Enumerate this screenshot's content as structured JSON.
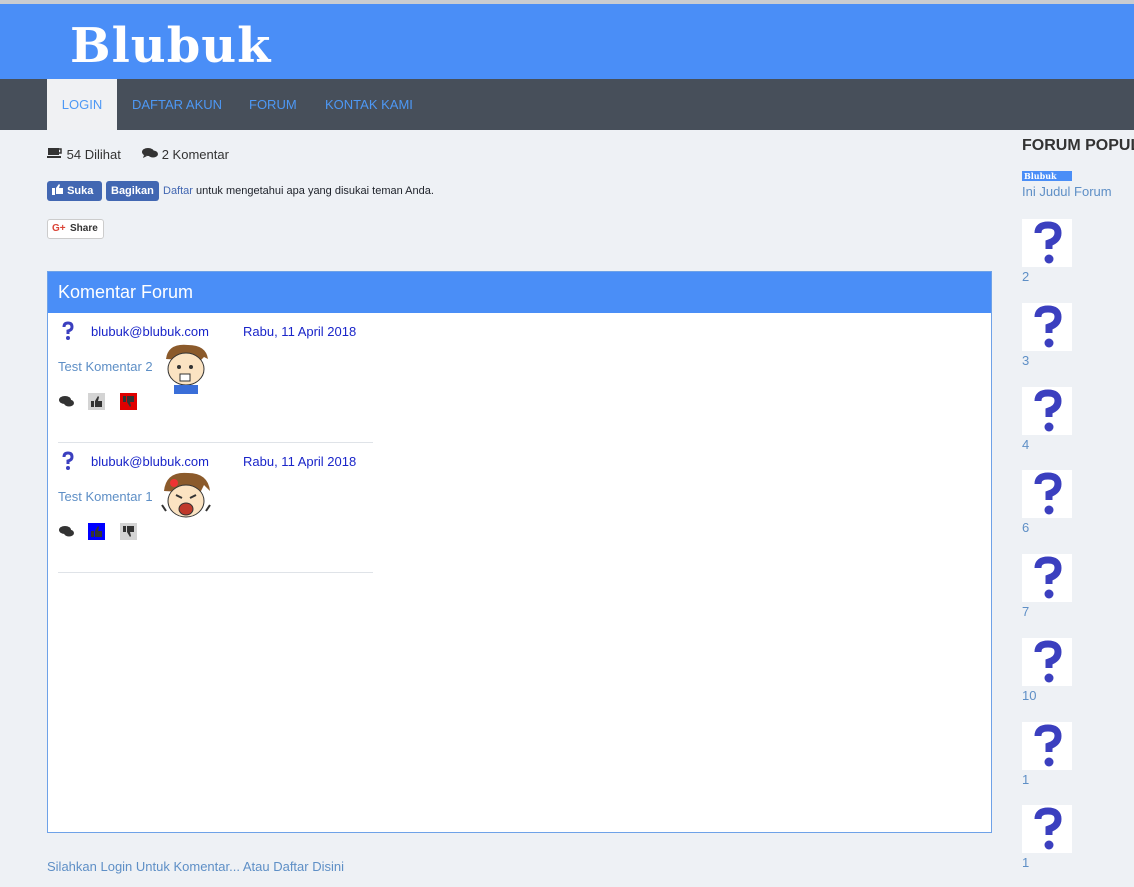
{
  "site": {
    "logo": "Blubuk"
  },
  "nav": {
    "items": [
      "LOGIN",
      "DAFTAR AKUN",
      "FORUM",
      "KONTAK KAMI"
    ]
  },
  "stats": {
    "views": "54 Dilihat",
    "comments": "2 Komentar"
  },
  "facebook": {
    "like_label": "Suka",
    "share_label": "Bagikan",
    "signup_link": "Daftar",
    "text": " untuk mengetahui apa yang disukai teman Anda."
  },
  "gplus": {
    "share_label": "Share"
  },
  "panel": {
    "title": "Komentar Forum",
    "comments": [
      {
        "email": "blubuk@blubuk.com",
        "date": "Rabu, 11 April 2018",
        "text": "Test Komentar 2",
        "liked": false,
        "disliked": true
      },
      {
        "email": "blubuk@blubuk.com",
        "date": "Rabu, 11 April 2018",
        "text": "Test Komentar 1",
        "liked": true,
        "disliked": false
      }
    ]
  },
  "footer_text": "Silahkan Login Untuk Komentar... Atau Daftar Disini",
  "sidebar": {
    "title": "FORUM POPULER",
    "top_logo": "Blubuk",
    "top_title": "Ini Judul Forum",
    "items": [
      "2",
      "3",
      "4",
      "6",
      "7",
      "10",
      "1",
      "1"
    ]
  },
  "colors": {
    "header": "#4a8ef7",
    "navbar": "#474f5a",
    "link": "#5e8fc6",
    "email": "#1a25c9",
    "like_active": "#0000ff",
    "dislike_active": "#e00000"
  },
  "icons": {
    "views": "coffee-icon",
    "comments": "comments-icon",
    "reply": "reply-icon",
    "like": "thumbs-up-icon",
    "dislike": "thumbs-down-icon",
    "avatar": "question-mark-icon"
  }
}
